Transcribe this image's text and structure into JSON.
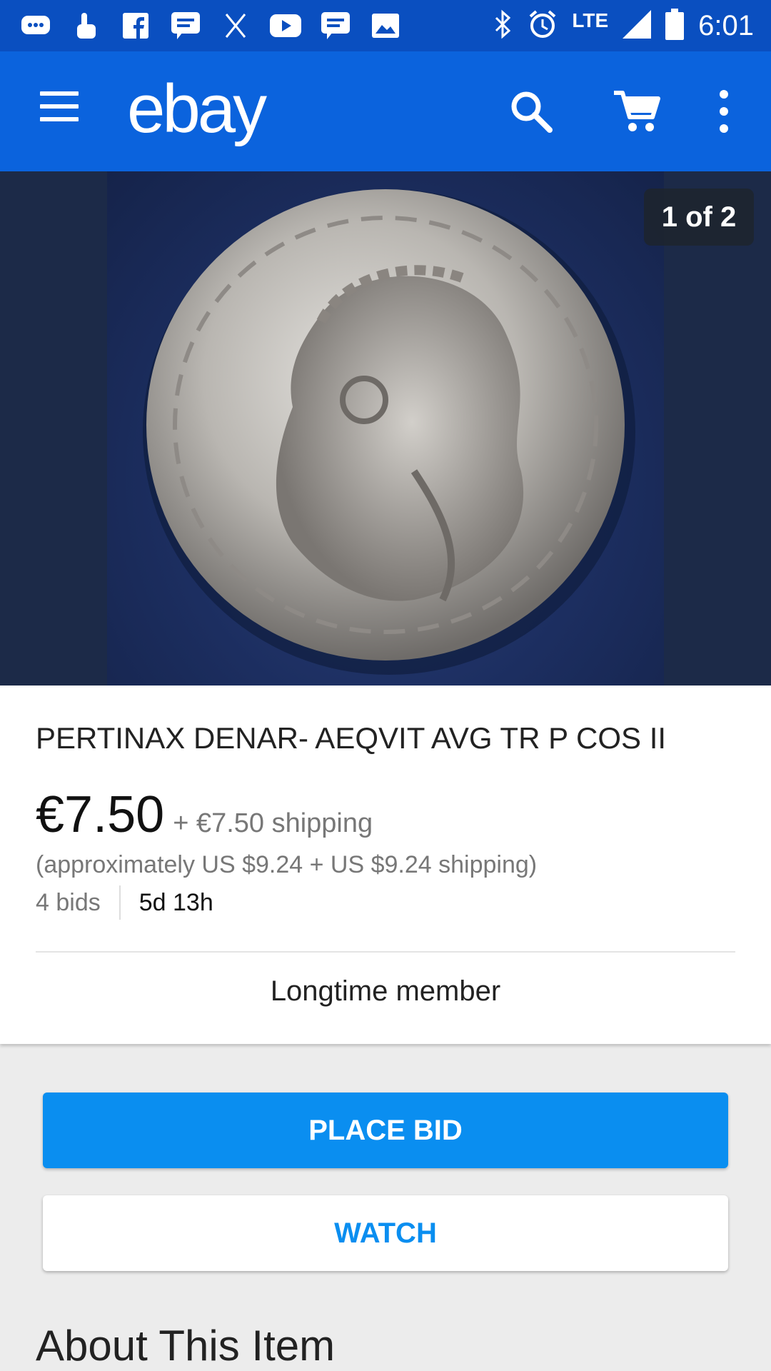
{
  "status_bar": {
    "time": "6:01",
    "network": "LTE",
    "left_icons": [
      "chat-icon",
      "touch-icon",
      "facebook-icon",
      "message-icon",
      "x-icon",
      "youtube-icon",
      "message-icon",
      "image-icon"
    ],
    "right_icons": [
      "bluetooth-icon",
      "alarm-icon",
      "signal-icon",
      "battery-icon"
    ]
  },
  "app_bar": {
    "logo": "ebay",
    "colors": {
      "bar": "#0b63dd",
      "status": "#0a4fc0"
    }
  },
  "gallery": {
    "counter": "1 of 2"
  },
  "item": {
    "title": "PERTINAX DENAR- AEQVIT AVG TR P COS II",
    "price": "€7.50",
    "shipping": "+ €7.50 shipping",
    "approx": "(approximately US $9.24 + US $9.24 shipping)",
    "bids": "4 bids",
    "time_left": "5d 13h",
    "seller_badge": "Longtime member"
  },
  "actions": {
    "place_bid": "PLACE BID",
    "watch": "WATCH",
    "accent": "#0a8ef0"
  },
  "sections": {
    "about": "About This Item"
  }
}
